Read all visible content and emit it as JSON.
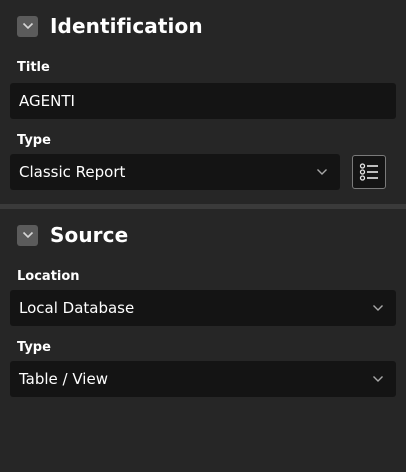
{
  "identification": {
    "heading": "Identification",
    "title_label": "Title",
    "title_value": "AGENTI",
    "type_label": "Type",
    "type_value": "Classic Report"
  },
  "source": {
    "heading": "Source",
    "location_label": "Location",
    "location_value": "Local Database",
    "type_label": "Type",
    "type_value": "Table / View"
  },
  "icons": {
    "collapse": "chevron-down-icon",
    "select": "chevron-down-icon",
    "list": "list-icon"
  }
}
